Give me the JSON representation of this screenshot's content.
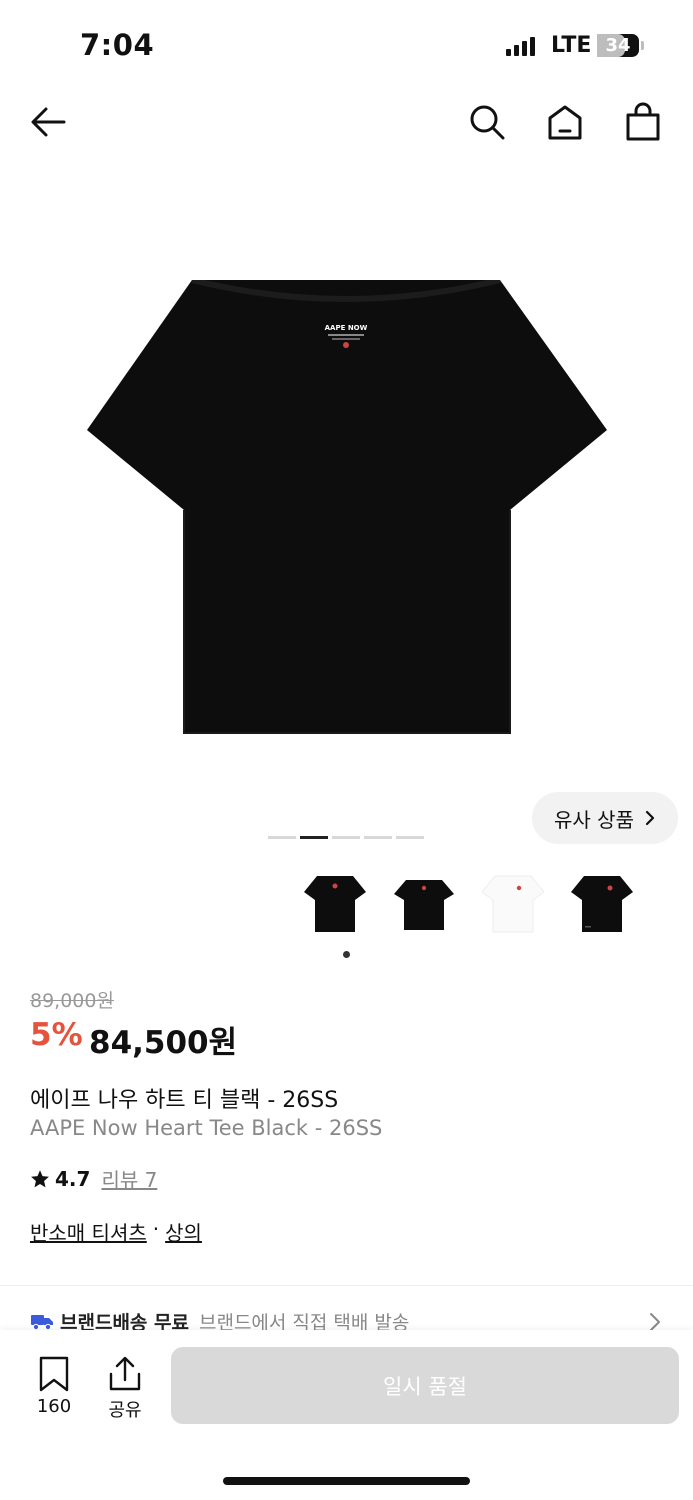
{
  "status_bar": {
    "time": "7:04",
    "network": "LTE",
    "battery": "34",
    "battery_level_percent": 34
  },
  "nav": {
    "back_icon": "arrow-left-icon",
    "search_icon": "search-icon",
    "home_icon": "home-icon",
    "cart_icon": "shopping-bag-icon"
  },
  "product": {
    "image_logo_text": "AAPE NOW",
    "similar_button": "유사 상품",
    "image_count": 5,
    "active_image_index": 1,
    "thumbnails": [
      {
        "color": "black"
      },
      {
        "color": "black"
      },
      {
        "color": "white"
      },
      {
        "color": "black"
      }
    ],
    "original_price": "89,000원",
    "discount": "5%",
    "price": "84,500원",
    "name_ko": "에이프 나우 하트 티 블랙 - 26SS",
    "name_en": "AAPE Now Heart Tee Black - 26SS",
    "rating": "4.7",
    "review": "리뷰 7",
    "category": {
      "sub": "반소매 티셔츠",
      "separator": "·",
      "main": "상의"
    }
  },
  "shipping": {
    "icon": "truck-icon",
    "label": "브랜드배송 무료",
    "desc": "브랜드에서 직접 택배 발송"
  },
  "bottom": {
    "save_count": "160",
    "share_label": "공유",
    "soldout_label": "일시 품절"
  },
  "colors": {
    "accent_discount": "#e5533d",
    "soldout_bg": "#d9d9d9",
    "text": "#111111",
    "muted": "#888888"
  }
}
